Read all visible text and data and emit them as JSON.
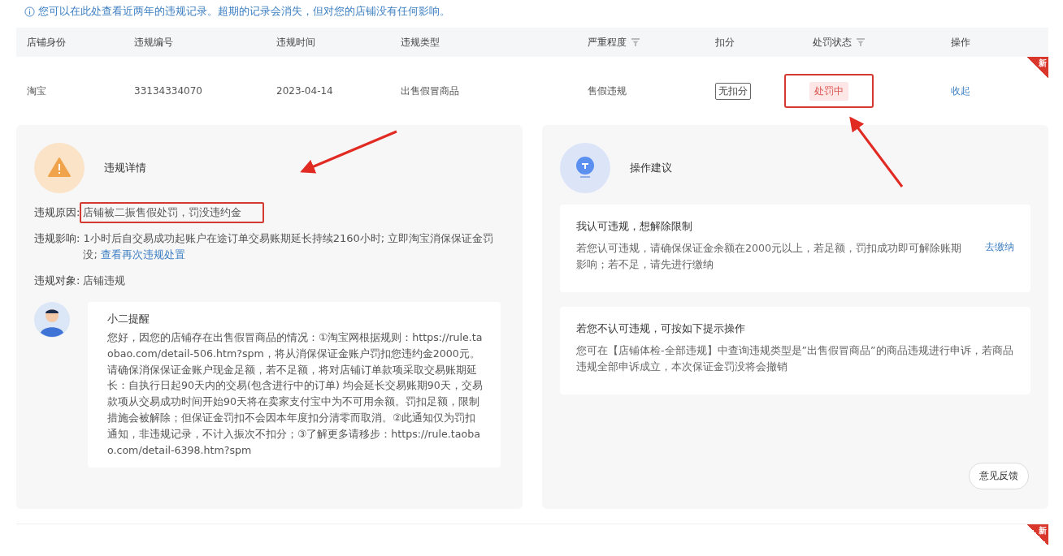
{
  "notice": "您可以在此处查看近两年的违规记录。超期的记录会消失，但对您的店铺没有任何影响。",
  "table": {
    "columns": [
      {
        "label": "店铺身份",
        "filter": false
      },
      {
        "label": "违规编号",
        "filter": false
      },
      {
        "label": "违规时间",
        "filter": false
      },
      {
        "label": "违规类型",
        "filter": false
      },
      {
        "label": "严重程度",
        "filter": true
      },
      {
        "label": "扣分",
        "filter": false
      },
      {
        "label": "处罚状态",
        "filter": true
      },
      {
        "label": "操作",
        "filter": false
      }
    ],
    "rows": [
      {
        "shop": "淘宝",
        "id": "33134334070",
        "time": "2023-04-14",
        "type": "出售假冒商品",
        "severity": "售假违规",
        "points": "无扣分",
        "status": {
          "text": "处罚中",
          "kind": "penalizing"
        },
        "action": "收起",
        "badge": "新"
      }
    ],
    "next_row": {
      "badge": "新"
    }
  },
  "details": {
    "title": "违规详情",
    "fields": [
      {
        "label": "违规原因:",
        "value": "店铺被二振售假处罚，罚没违约金",
        "highlighted": true
      },
      {
        "label": "违规影响:",
        "value": "1小时后自交易成功起账户在途订单交易账期延长持续2160小时; 立即淘宝消保保证金罚没;",
        "link": "查看再次违规处置",
        "highlighted": false
      },
      {
        "label": "违规对象:",
        "value": "店铺违规",
        "highlighted": false
      }
    ],
    "reminder": {
      "title": "小二提醒",
      "body": "您好，因您的店铺存在出售假冒商品的情况：①淘宝网根据规则：https://rule.taobao.com/detail-506.htm?spm，将从消保保证金账户罚扣您违约金2000元。请确保消保保证金账户现金足额，若不足额，将对店铺订单款项采取交易账期延长：自执行日起90天内的交易(包含进行中的订单) 均会延长交易账期90天，交易款项从交易成功时间开始90天将在卖家支付宝中为不可用余额。罚扣足额，限制措施会被解除；但保证金罚扣不会因本年度扣分清零而取消。②此通知仅为罚扣通知，非违规记录，不计入振次不扣分；③了解更多请移步：https://rule.taobao.com/detail-6398.htm?spm"
    }
  },
  "advice": {
    "title": "操作建议",
    "cards": [
      {
        "title": "我认可违规，想解除限制",
        "body": "若您认可违规，请确保保证金余额在2000元以上，若足额，罚扣成功即可解除账期影响；若不足，请先进行缴纳",
        "action": "去缴纳"
      },
      {
        "title": "若您不认可违规，可按如下提示操作",
        "body": "您可在【店铺体检-全部违规】中查询违规类型是”出售假冒商品”的商品违规进行申诉，若商品违规全部申诉成立，本次保证金罚没将会撤销"
      }
    ],
    "feedback": "意见反馈"
  }
}
